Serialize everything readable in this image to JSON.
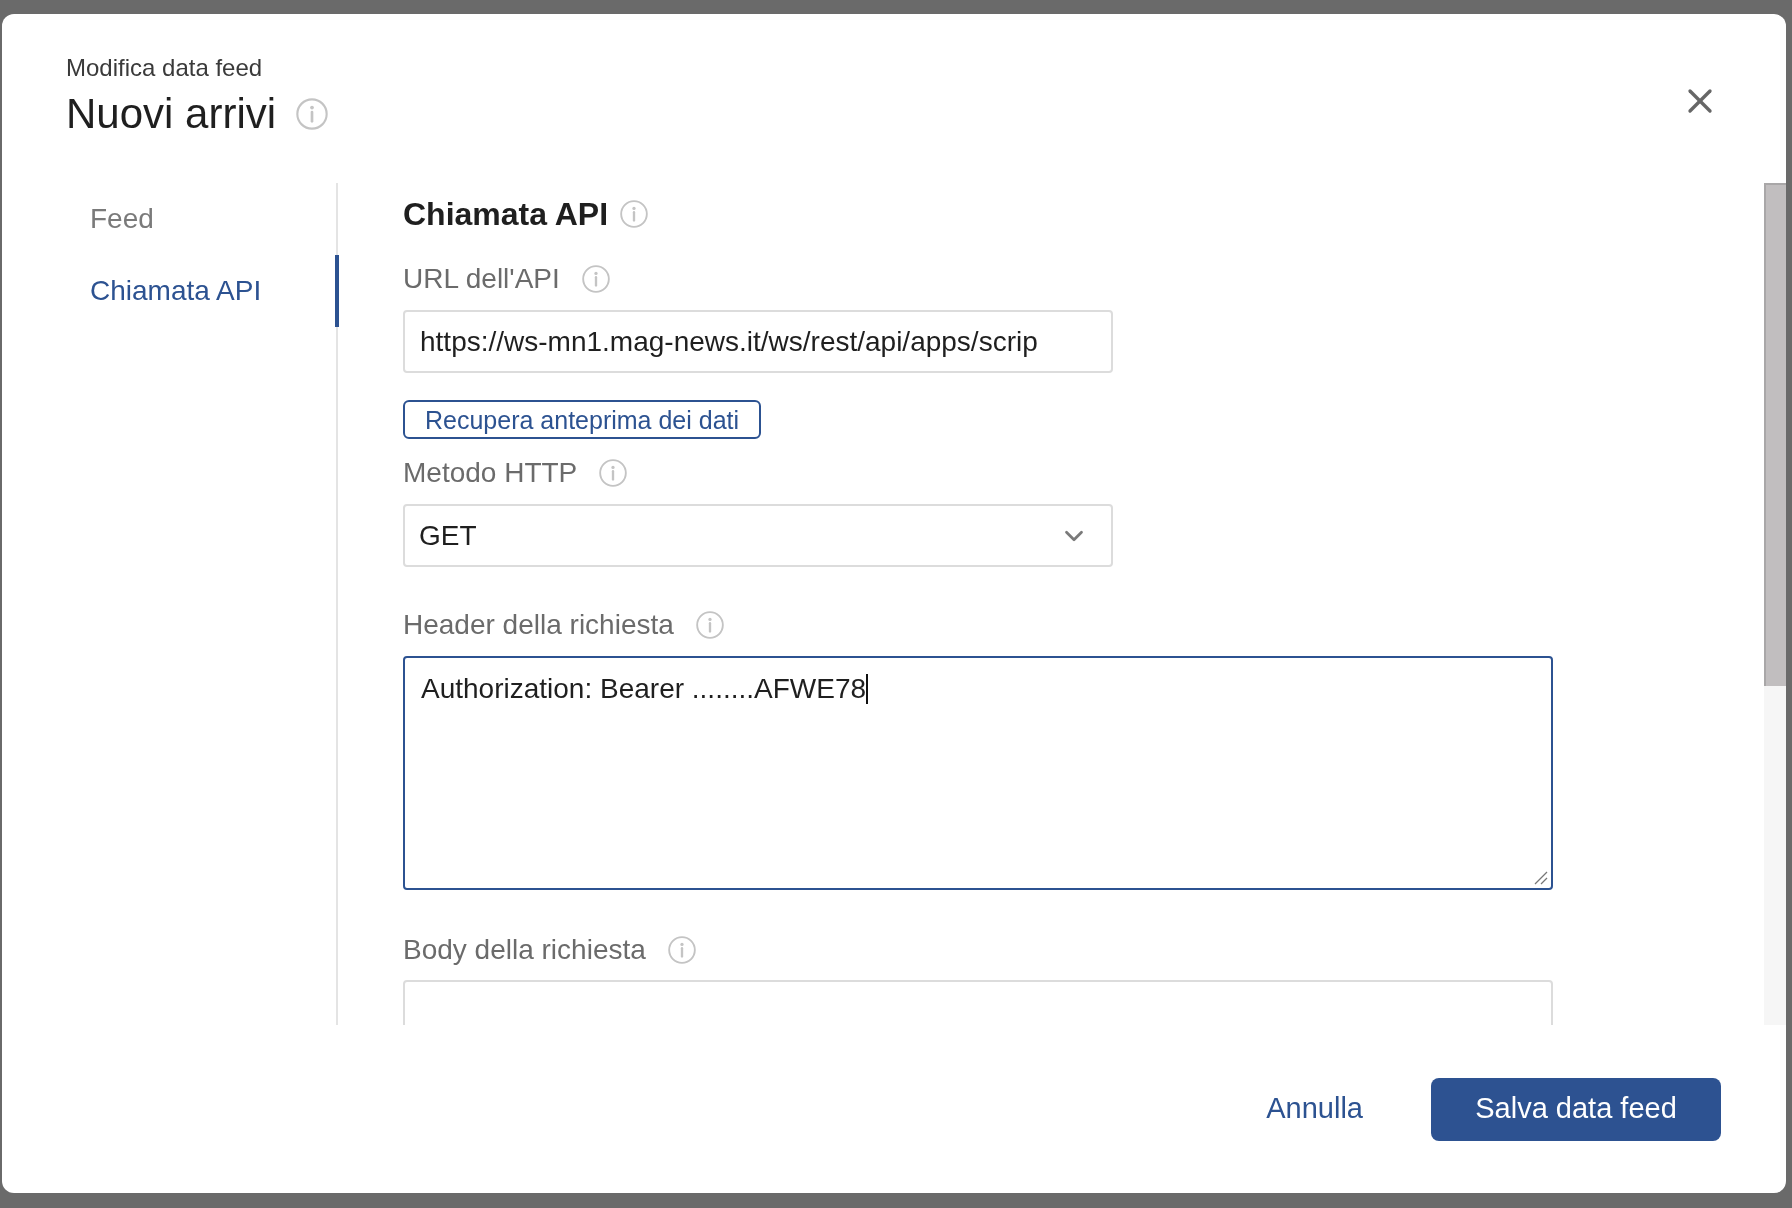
{
  "dialog": {
    "subtitle": "Modifica data feed",
    "title": "Nuovi arrivi"
  },
  "nav": [
    {
      "label": "Feed",
      "selected": false
    },
    {
      "label": "Chiamata API",
      "selected": true
    }
  ],
  "section": {
    "title": "Chiamata API"
  },
  "url_field": {
    "label": "URL dell'API",
    "value": "https://ws-mn1.mag-news.it/ws/rest/api/apps/scrip"
  },
  "preview_button": {
    "label": "Recupera anteprima dei dati"
  },
  "method_field": {
    "label": "Metodo HTTP",
    "value": "GET"
  },
  "header_field": {
    "label": "Header della richiesta",
    "value": "Authorization: Bearer ........AFWE78",
    "focused": true
  },
  "body_field": {
    "label": "Body della richiesta",
    "focused": false
  },
  "footer": {
    "cancel": "Annulla",
    "save": "Salva data feed"
  }
}
